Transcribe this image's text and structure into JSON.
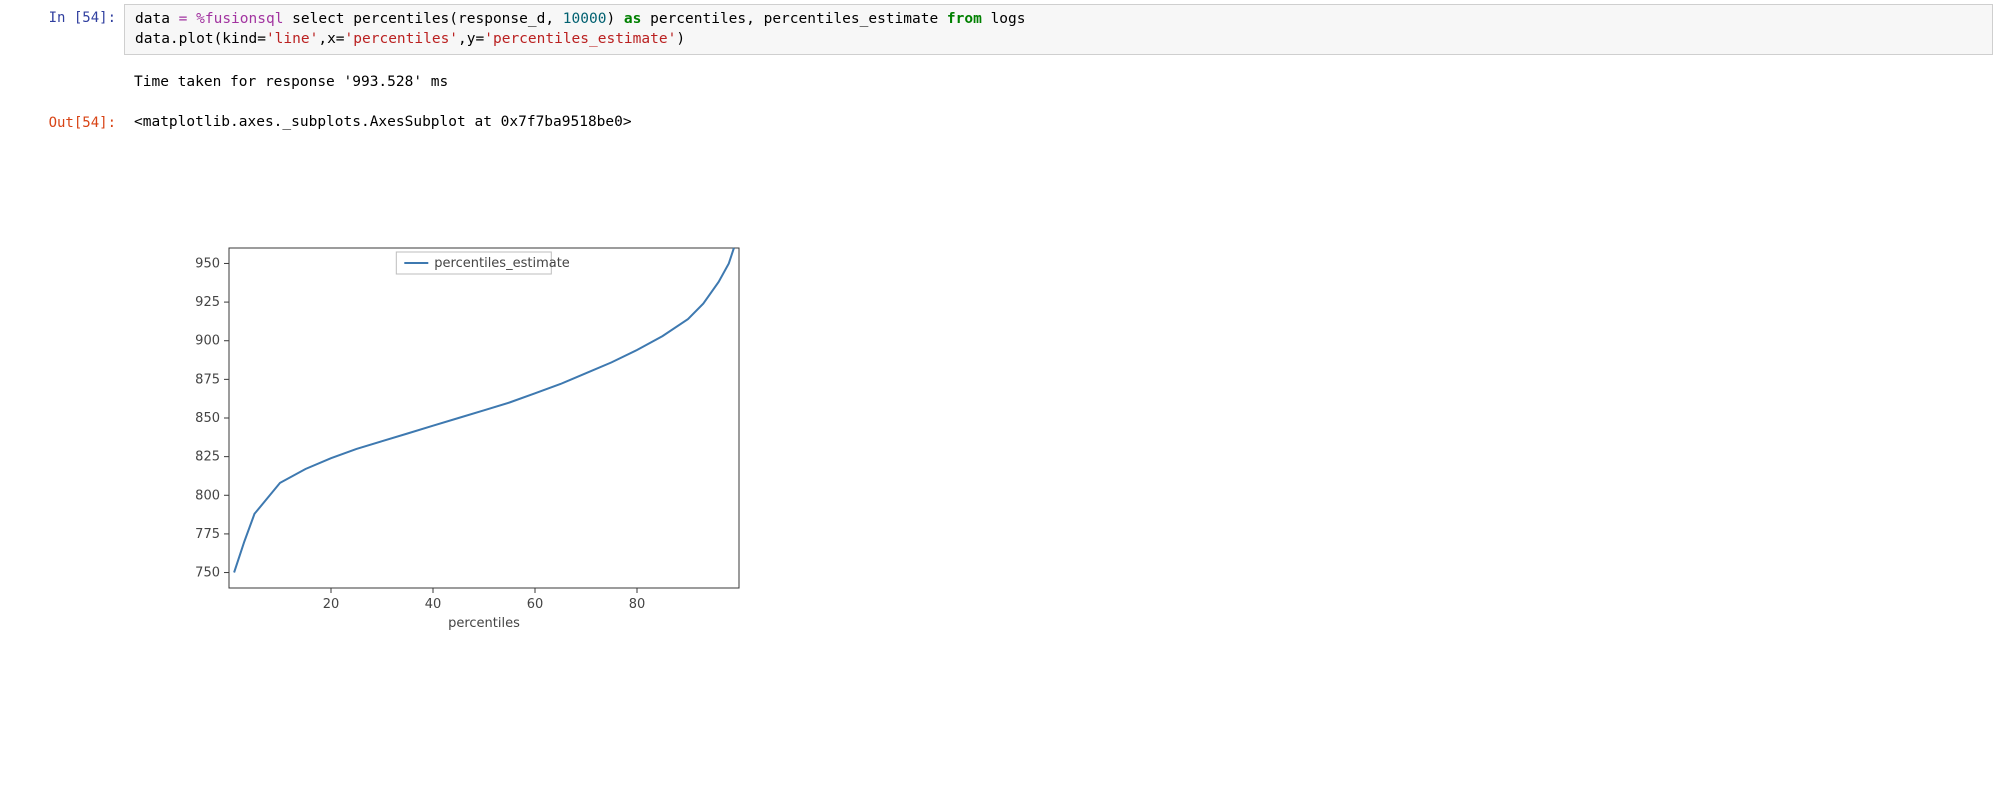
{
  "cell": {
    "in_prompt": "In [54]:",
    "out_prompt": "Out[54]:",
    "code": {
      "l1_pre": "data ",
      "l1_eq": "= ",
      "l1_magic": "%fusionsql ",
      "l1_sel": "select percentiles(response_d, ",
      "l1_num": "10000",
      "l1_close": ") ",
      "l1_as": "as",
      "l1_mid": " percentiles, percentiles_estimate ",
      "l1_from": "from",
      "l1_end": " logs",
      "l2_pre": "data.plot(kind=",
      "l2_s1": "'line'",
      "l2_mid1": ",x=",
      "l2_s2": "'percentiles'",
      "l2_mid2": ",y=",
      "l2_s3": "'percentiles_estimate'",
      "l2_end": ")"
    },
    "stdout": "Time taken for response '993.528' ms",
    "repr": "<matplotlib.axes._subplots.AxesSubplot at 0x7f7ba9518be0>"
  },
  "chart_data": {
    "type": "line",
    "series": [
      {
        "name": "percentiles_estimate",
        "x": [
          1,
          3,
          5,
          8,
          10,
          15,
          20,
          25,
          30,
          35,
          40,
          45,
          50,
          55,
          60,
          65,
          70,
          75,
          80,
          85,
          90,
          93,
          96,
          98,
          99
        ],
        "y": [
          750,
          770,
          788,
          800,
          808,
          817,
          824,
          830,
          835,
          840,
          845,
          850,
          855,
          860,
          866,
          872,
          879,
          886,
          894,
          903,
          914,
          924,
          938,
          950,
          960
        ]
      }
    ],
    "xlabel": "percentiles",
    "ylabel": "",
    "xticks": [
      20,
      40,
      60,
      80
    ],
    "yticks": [
      750,
      775,
      800,
      825,
      850,
      875,
      900,
      925,
      950
    ],
    "xlim": [
      0,
      100
    ],
    "ylim": [
      740,
      960
    ],
    "legend": [
      "percentiles_estimate"
    ],
    "legend_loc": "upper center"
  }
}
